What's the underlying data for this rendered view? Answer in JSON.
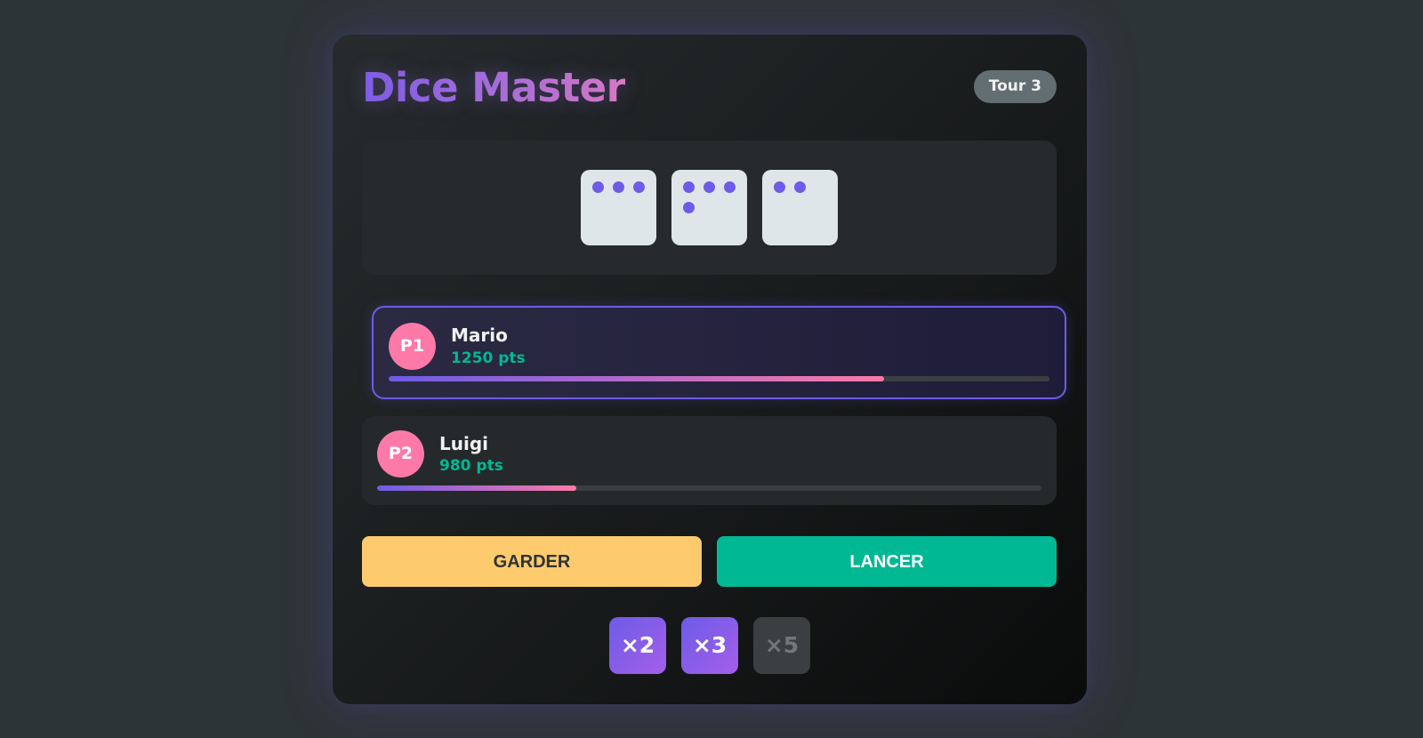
{
  "game": {
    "title": "Dice Master",
    "round_label": "Tour 3"
  },
  "dice": [
    {
      "value": 3
    },
    {
      "value": 4
    },
    {
      "value": 2
    }
  ],
  "players": [
    {
      "tag": "P1",
      "name": "Mario",
      "score": "1250 pts",
      "progress_fraction": 0.75,
      "active": true
    },
    {
      "tag": "P2",
      "name": "Luigi",
      "score": "980 pts",
      "progress_fraction": 0.3,
      "active": false
    }
  ],
  "actions": {
    "keep_label": "GARDER",
    "roll_label": "LANCER"
  },
  "multipliers": [
    {
      "label": "×2",
      "enabled": true
    },
    {
      "label": "×3",
      "enabled": true
    },
    {
      "label": "×5",
      "enabled": false
    }
  ],
  "colors": {
    "accent": "#6c5ce7",
    "pink": "#fd79a8",
    "score_green": "#00b894",
    "keep_yellow": "#fdcb6e",
    "roll_green": "#00b894",
    "badge_gray": "#636e72"
  }
}
